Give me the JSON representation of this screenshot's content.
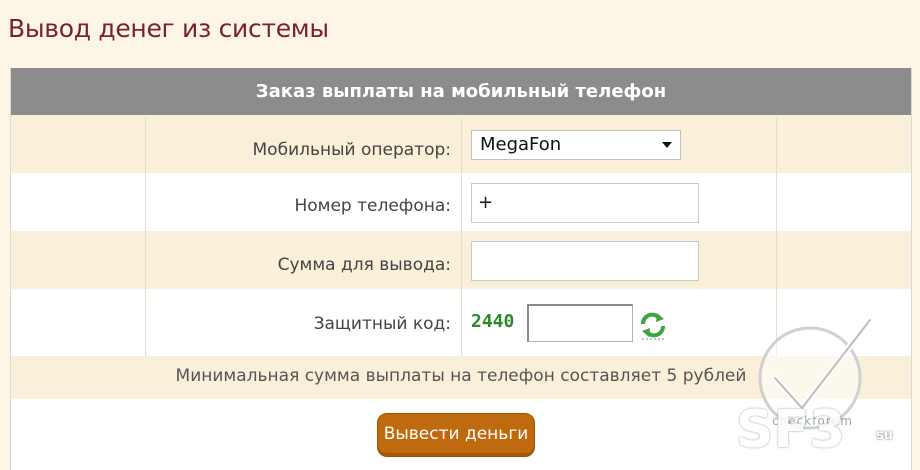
{
  "page": {
    "title": "Вывод денег из системы"
  },
  "form": {
    "header": "Заказ выплаты на мобильный телефон",
    "operator": {
      "label": "Мобильный оператор:",
      "value": "MegaFon"
    },
    "phone": {
      "label": "Номер телефона:",
      "value": "+"
    },
    "amount": {
      "label": "Сумма для вывода:",
      "value": ""
    },
    "captcha": {
      "label": "Защитный код:",
      "code": "2440",
      "value": ""
    },
    "note": "Минимальная сумма выплаты на телефон составляет 5 рублей",
    "submit_label": "Вывести деньги"
  },
  "watermark": {
    "text": "SF3",
    "suffix": "su",
    "small": "checkforum"
  },
  "colors": {
    "title": "#7a1f33",
    "header_bg": "#8c8c8c",
    "row_beige": "#faefd9",
    "button": "#c06a10",
    "captcha": "#2a8a2a"
  },
  "icons": {
    "refresh": "refresh-icon",
    "dropdown": "chevron-down-icon"
  }
}
